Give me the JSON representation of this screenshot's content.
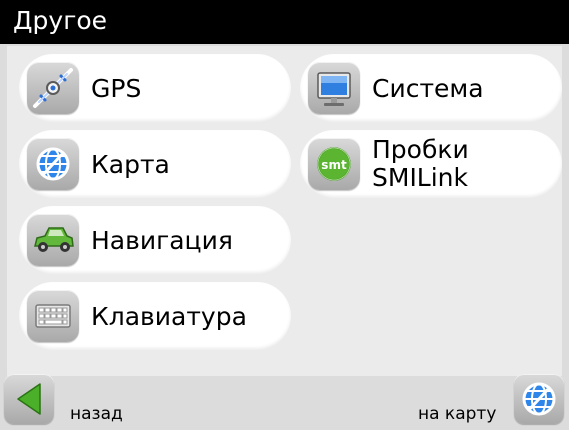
{
  "window": {
    "title": "Другое"
  },
  "menu": {
    "gps": {
      "label": "GPS",
      "icon": "satellite-icon"
    },
    "map": {
      "label": "Карта",
      "icon": "globe-icon"
    },
    "navigation": {
      "label": "Навигация",
      "icon": "car-icon"
    },
    "keyboard": {
      "label": "Клавиатура",
      "icon": "keyboard-icon"
    },
    "system": {
      "label": "Система",
      "icon": "monitor-icon"
    },
    "traffic": {
      "label_line1": "Пробки",
      "label_line2": "SMILink",
      "icon": "smilink-icon",
      "badge": "smt"
    }
  },
  "footer": {
    "back": {
      "label": "назад",
      "icon": "back-arrow-icon"
    },
    "to_map": {
      "label": "на карту",
      "icon": "globe-icon"
    }
  },
  "colors": {
    "title_bar": "#000000",
    "background": "#dcdcdc",
    "button": "#ffffff",
    "back_arrow": "#4caf2a",
    "globe": "#1e88e5"
  }
}
